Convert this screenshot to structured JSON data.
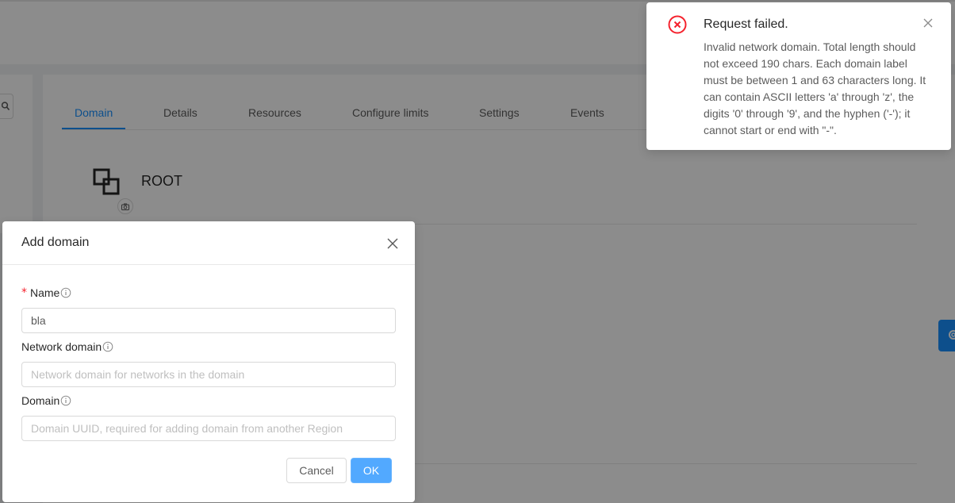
{
  "tabs": [
    {
      "label": "Domain",
      "active": true
    },
    {
      "label": "Details",
      "active": false
    },
    {
      "label": "Resources",
      "active": false
    },
    {
      "label": "Configure limits",
      "active": false
    },
    {
      "label": "Settings",
      "active": false
    },
    {
      "label": "Events",
      "active": false
    }
  ],
  "domain": {
    "name": "ROOT",
    "icon": "block-icon"
  },
  "modal": {
    "title": "Add domain",
    "fields": {
      "name": {
        "label": "Name",
        "required": true,
        "value": "bla",
        "placeholder": ""
      },
      "network_domain": {
        "label": "Network domain",
        "value": "",
        "placeholder": "Network domain for networks in the domain"
      },
      "domain": {
        "label": "Domain",
        "value": "",
        "placeholder": "Domain UUID, required for adding domain from another Region"
      }
    },
    "cancel_label": "Cancel",
    "ok_label": "OK"
  },
  "notification": {
    "title": "Request failed.",
    "description": "Invalid network domain. Total length should not exceed 190 chars. Each domain label must be between 1 and 63 characters long. It can contain ASCII letters 'a' through 'z', the digits '0' through '9', and the hyphen ('-'); it cannot start or end with \"-\".",
    "icon": "close-circle-icon",
    "icon_color": "#f5222d"
  },
  "colors": {
    "primary": "#1890ff",
    "ok_button": "#52a9ff",
    "error": "#f5222d"
  }
}
